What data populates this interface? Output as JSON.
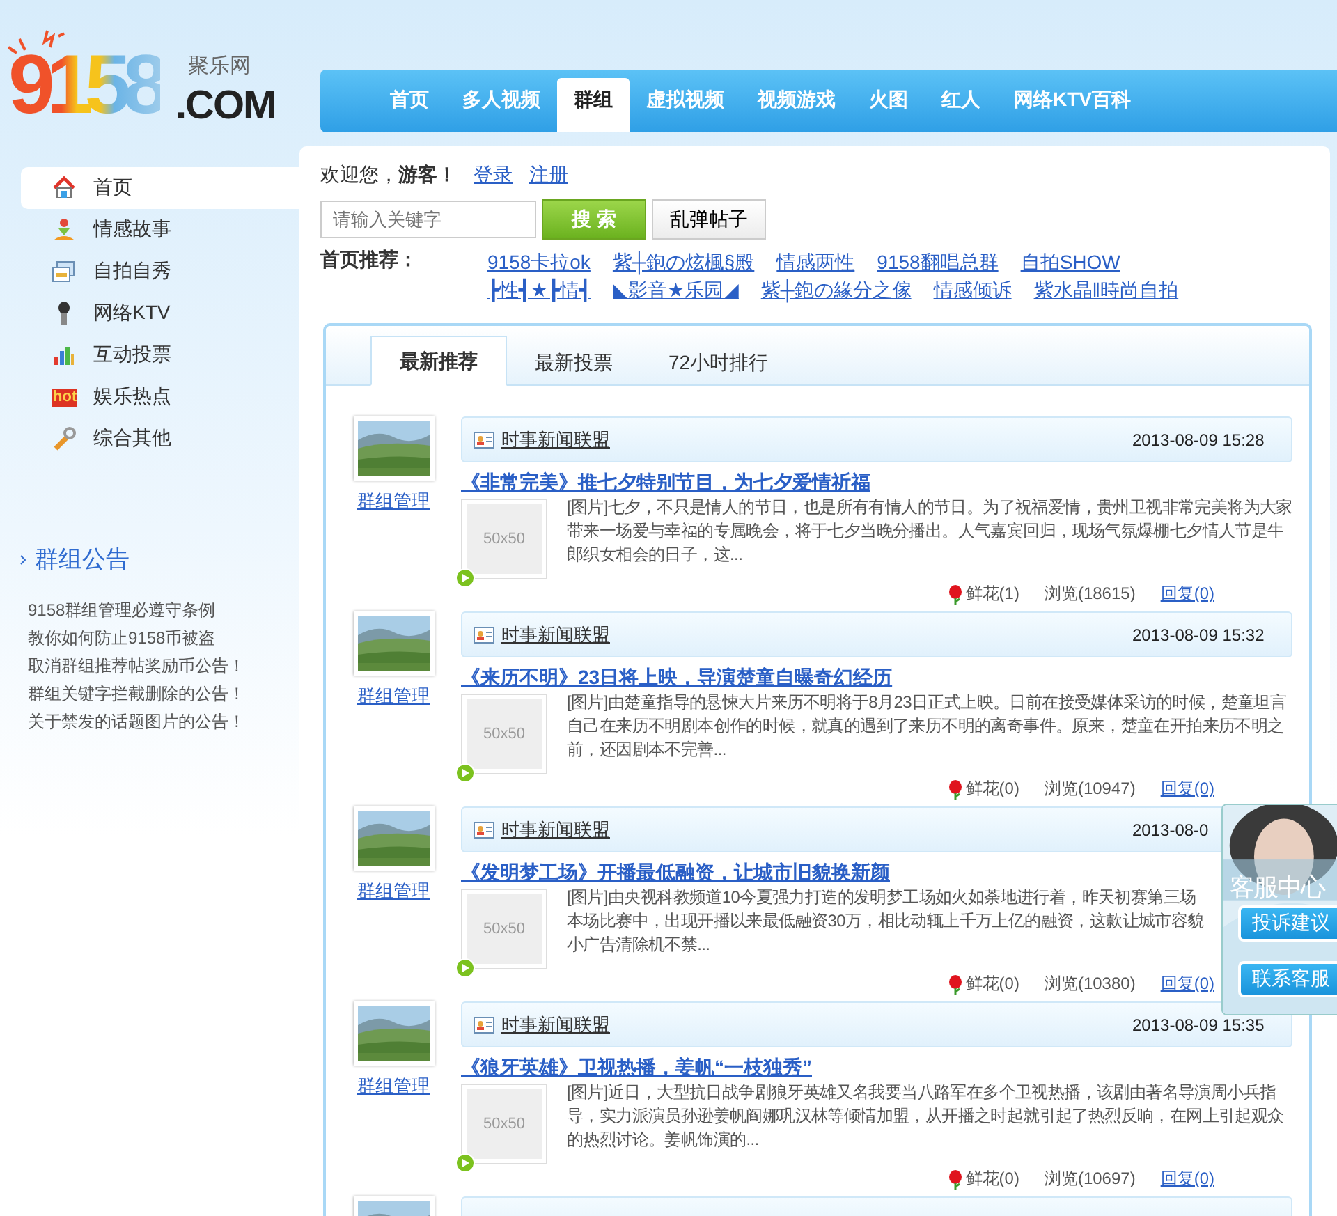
{
  "logo": {
    "digits": "9158",
    "domain": ".COM",
    "subtitle": "聚乐网"
  },
  "nav": [
    {
      "label": "首页",
      "selected": false
    },
    {
      "label": "多人视频",
      "selected": false
    },
    {
      "label": "群组",
      "selected": true
    },
    {
      "label": "虚拟视频",
      "selected": false
    },
    {
      "label": "视频游戏",
      "selected": false
    },
    {
      "label": "火图",
      "selected": false
    },
    {
      "label": "红人",
      "selected": false
    },
    {
      "label": "网络KTV百科",
      "selected": false
    }
  ],
  "sidebar": {
    "items": [
      {
        "label": "首页",
        "selected": true
      },
      {
        "label": "情感故事",
        "selected": false
      },
      {
        "label": "自拍自秀",
        "selected": false
      },
      {
        "label": "网络KTV",
        "selected": false
      },
      {
        "label": "互动投票",
        "selected": false
      },
      {
        "label": "娱乐热点",
        "selected": false,
        "badge": "hot"
      },
      {
        "label": "综合其他",
        "selected": false
      }
    ],
    "notice_title": "群组公告",
    "notices": [
      "9158群组管理必遵守条例",
      "教你如何防止9158币被盗",
      "取消群组推荐帖奖励币公告！",
      "群组关键字拦截删除的公告！",
      "关于禁发的话题图片的公告！"
    ]
  },
  "welcome": {
    "text": "欢迎您，**游客！**",
    "login": "登录",
    "register": "注册"
  },
  "search": {
    "placeholder": "请输入关键字",
    "button": "搜 索",
    "random": "乱弹帖子"
  },
  "recommend": {
    "label": "首页推荐：",
    "rows": [
      [
        "9158卡拉ok",
        "紫┼鉋の炫楓§殿",
        "情感两性",
        "9158翻唱总群",
        "自拍SHOW"
      ],
      [
        "┣性┫★┣情┫",
        "◣影音★乐园◢",
        "紫┼鉋の緣分之傢",
        "情感倾诉",
        "紫水晶‖時尚自拍"
      ]
    ]
  },
  "tabs": [
    {
      "label": "最新推荐",
      "selected": true
    },
    {
      "label": "最新投票",
      "selected": false
    },
    {
      "label": "72小时排行",
      "selected": false
    }
  ],
  "posts": [
    {
      "kind": "full",
      "admin": "群组管理",
      "group": "时事新闻联盟",
      "time": "2013-08-09 15:28",
      "title": "《非常完美》推七夕特别节目，为七夕爱情祈福",
      "thumb": "50x50",
      "lines": [
        "[图片]七夕，不只是情人的节日，也是所有有情人的节日。为了祝福爱情，贵州卫视非常完美将为大家",
        "带来一场爱与幸福的专属晚会，将于七夕当晚分播出。人气嘉宾回归，现场气氛爆棚七夕情人节是牛",
        "郎织女相会的日子，这..."
      ],
      "flowers": "鲜花(1)",
      "views": "浏览(18615)",
      "reply": "回复(0)"
    },
    {
      "kind": "full",
      "admin": "群组管理",
      "group": "时事新闻联盟",
      "time": "2013-08-09 15:32",
      "title": "《来历不明》23日将上映，导演楚童自曝奇幻经历",
      "thumb": "50x50",
      "lines": [
        "[图片]由楚童指导的悬悚大片来历不明将于8月23日正式上映。日前在接受媒体采访的时候，楚童坦言",
        "自己在来历不明剧本创作的时候，就真的遇到了来历不明的离奇事件。原来，楚童在开拍来历不明之",
        "前，还因剧本不完善..."
      ],
      "flowers": "鲜花(0)",
      "views": "浏览(10947)",
      "reply": "回复(0)"
    },
    {
      "kind": "full",
      "admin": "群组管理",
      "group": "时事新闻联盟",
      "time": "2013-08-0",
      "title": "《发明梦工场》开播最低融资，让城市旧貌换新颜",
      "thumb": "50x50",
      "lines": [
        "[图片]由央视科教频道10今夏强力打造的发明梦工场如火如荼地进行着，昨天初赛第三场",
        "本场比赛中，出现开播以来最低融资30万，相比动辄上千万上亿的融资，这款让城市容貌",
        "小广告清除机不禁..."
      ],
      "flowers": "鲜花(0)",
      "views": "浏览(10380)",
      "reply": "回复(0)"
    },
    {
      "kind": "full",
      "admin": "群组管理",
      "group": "时事新闻联盟",
      "time": "2013-08-09 15:35",
      "title": "《狼牙英雄》卫视热播，姜帆“一枝独秀”",
      "thumb": "50x50",
      "lines": [
        "[图片]近日，大型抗日战争剧狼牙英雄又名我要当八路军在多个卫视热播，该剧由著名导演周小兵指",
        "导，实力派演员孙逊姜帆阎娜巩汉林等倾情加盟，从开播之时起就引起了热烈反响，在网上引起观众",
        "的热烈讨论。姜帆饰演的..."
      ],
      "flowers": "鲜花(0)",
      "views": "浏览(10697)",
      "reply": "回复(0)"
    },
    {
      "kind": "cut"
    }
  ],
  "service": {
    "title": "客服中心",
    "buttons": [
      "投诉建议",
      "联系客服"
    ]
  }
}
